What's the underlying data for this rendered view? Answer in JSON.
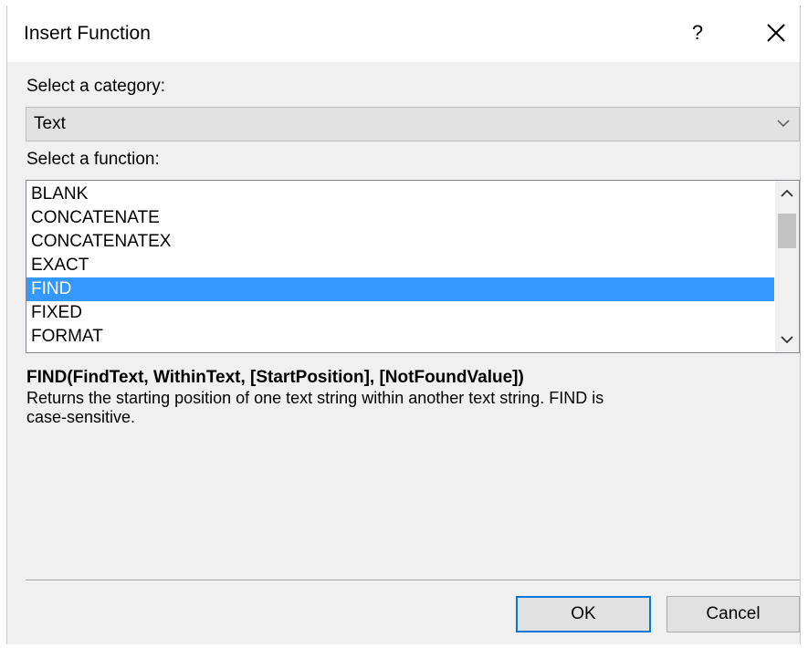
{
  "dialog": {
    "title": "Insert Function",
    "help_label": "?"
  },
  "category": {
    "label": "Select a category:",
    "selected": "Text"
  },
  "functions": {
    "label": "Select a function:",
    "items": [
      "BLANK",
      "CONCATENATE",
      "CONCATENATEX",
      "EXACT",
      "FIND",
      "FIXED",
      "FORMAT"
    ],
    "selected": "FIND"
  },
  "details": {
    "syntax": "FIND(FindText, WithinText, [StartPosition], [NotFoundValue])",
    "description": "Returns the starting position of one text string within another text string. FIND is case-sensitive."
  },
  "buttons": {
    "ok": "OK",
    "cancel": "Cancel"
  },
  "icons": {
    "close": "close-icon",
    "dropdown": "chevron-down-icon",
    "scroll_up": "chevron-up-icon",
    "scroll_down": "chevron-down-icon"
  },
  "colors": {
    "selection": "#3399ff",
    "ok_border": "#0078d7",
    "dialog_bg": "#f0f0f0"
  }
}
